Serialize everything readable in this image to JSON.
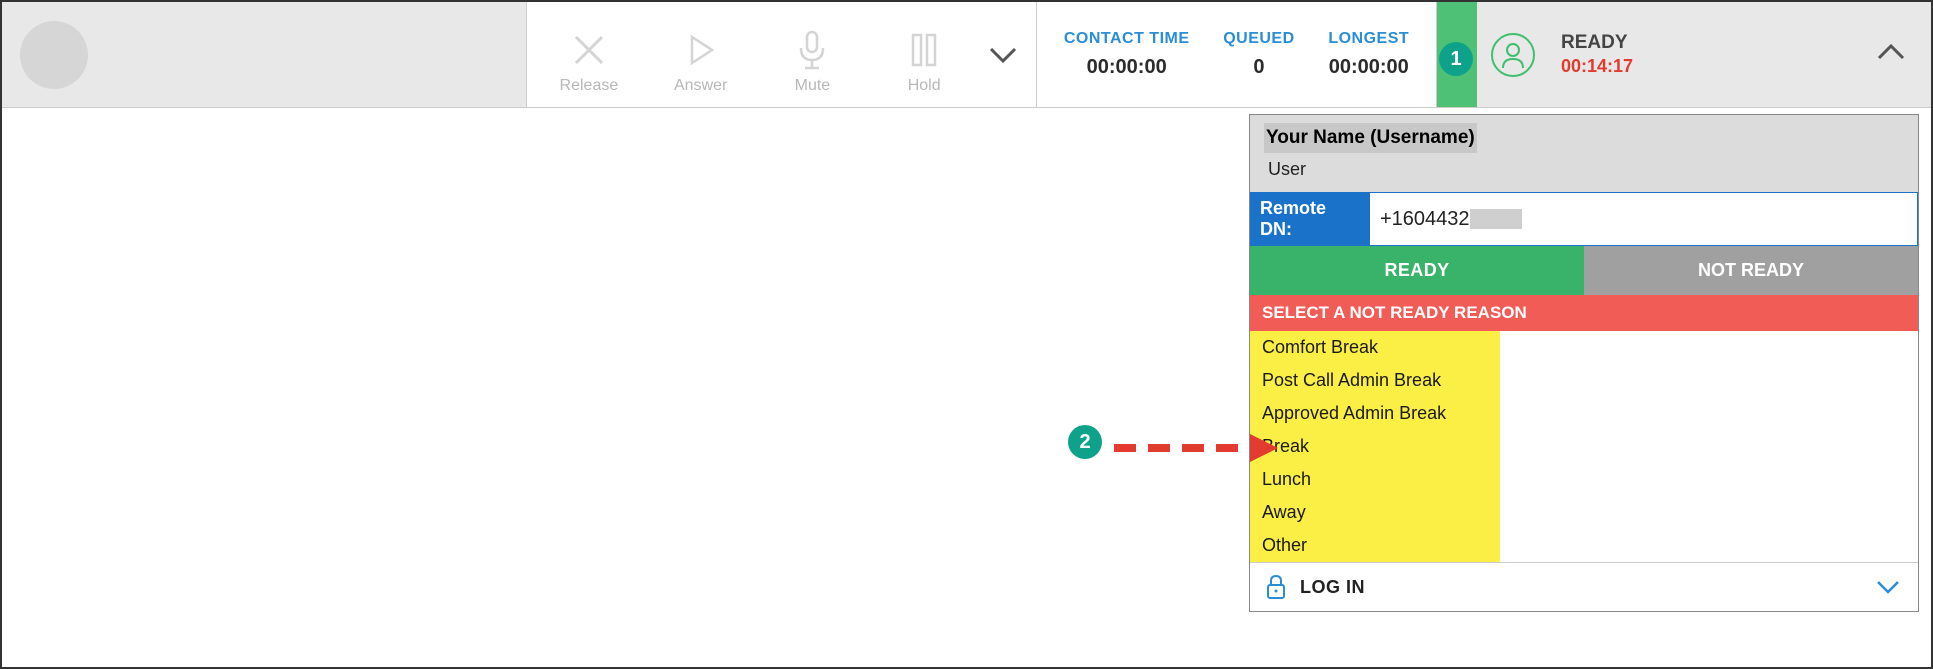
{
  "toolbar": {
    "release": "Release",
    "answer": "Answer",
    "mute": "Mute",
    "hold": "Hold"
  },
  "stats": {
    "contact_time_label": "CONTACT TIME",
    "contact_time_value": "00:00:00",
    "queued_label": "QUEUED",
    "queued_value": "0",
    "longest_label": "LONGEST",
    "longest_value": "00:00:00"
  },
  "status": {
    "state": "READY",
    "timer": "00:14:17"
  },
  "panel": {
    "name": "Your Name (Username)",
    "role": "User",
    "remote_dn_label": "Remote DN:",
    "remote_dn_value": "+1604432",
    "ready_btn": "READY",
    "notready_btn": "NOT READY",
    "reason_header": "SELECT A NOT READY REASON",
    "reasons": {
      "r0": "Comfort Break",
      "r1": "Post Call Admin Break",
      "r2": "Approved Admin Break",
      "r3": "Break",
      "r4": "Lunch",
      "r5": "Away",
      "r6": "Other"
    },
    "login": "LOG IN"
  },
  "callouts": {
    "c1": "1",
    "c2": "2"
  }
}
